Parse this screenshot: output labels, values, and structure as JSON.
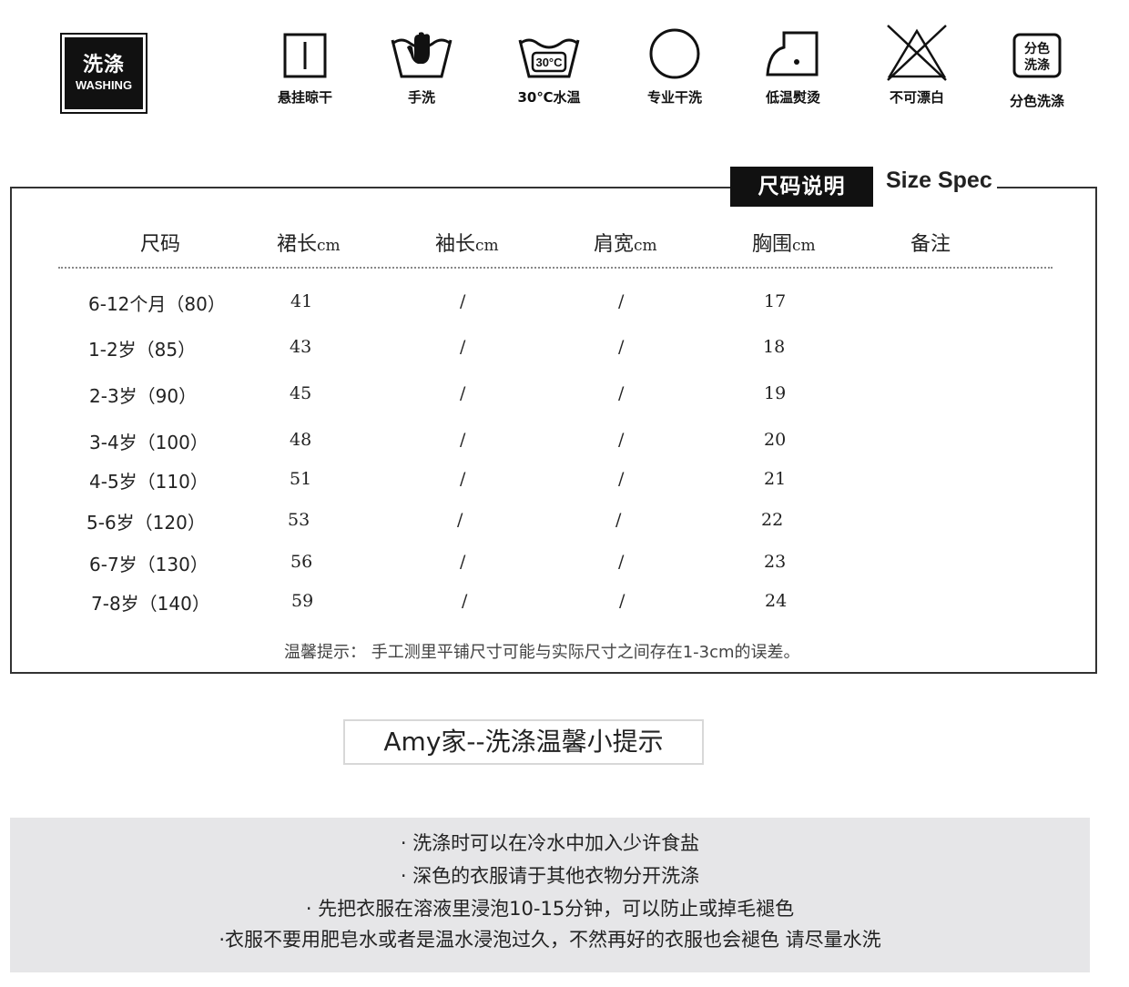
{
  "washing_badge": {
    "cn": "洗涤",
    "en": "WASHING"
  },
  "care_icons": [
    {
      "icon": "hang-dry-icon",
      "label": "悬挂晾干"
    },
    {
      "icon": "hand-wash-icon",
      "label": "手洗"
    },
    {
      "icon": "wash-30c-icon",
      "label": "30℃水温",
      "badge_text": "30°C"
    },
    {
      "icon": "dry-clean-icon",
      "label": "专业干洗"
    },
    {
      "icon": "iron-low-icon",
      "label": "低温熨烫"
    },
    {
      "icon": "no-bleach-icon",
      "label": "不可漂白"
    },
    {
      "icon": "separate-color-wash-icon",
      "label": "分色洗涤",
      "badge_line1": "分色",
      "badge_line2": "洗涤"
    }
  ],
  "size_spec": {
    "title_cn": "尺码说明",
    "title_en": "Size Spec",
    "headers": [
      {
        "text": "尺码",
        "unit": ""
      },
      {
        "text": "裙长",
        "unit": "cm"
      },
      {
        "text": "袖长",
        "unit": "cm"
      },
      {
        "text": "肩宽",
        "unit": "cm"
      },
      {
        "text": "胸围",
        "unit": "cm"
      },
      {
        "text": "备注",
        "unit": ""
      }
    ],
    "rows": [
      {
        "size": "6-12个月（80）",
        "skirt": "41",
        "sleeve": "/",
        "shoulder": "/",
        "chest": "17",
        "note": ""
      },
      {
        "size": "1-2岁（85）",
        "skirt": "43",
        "sleeve": "/",
        "shoulder": "/",
        "chest": "18",
        "note": ""
      },
      {
        "size": "2-3岁（90）",
        "skirt": "45",
        "sleeve": "/",
        "shoulder": "/",
        "chest": "19",
        "note": ""
      },
      {
        "size": "3-4岁（100）",
        "skirt": "48",
        "sleeve": "/",
        "shoulder": "/",
        "chest": "20",
        "note": ""
      },
      {
        "size": "4-5岁（110）",
        "skirt": "51",
        "sleeve": "/",
        "shoulder": "/",
        "chest": "21",
        "note": ""
      },
      {
        "size": "5-6岁（120）",
        "skirt": "53",
        "sleeve": "/",
        "shoulder": "/",
        "chest": "22",
        "note": ""
      },
      {
        "size": "6-7岁（130）",
        "skirt": "56",
        "sleeve": "/",
        "shoulder": "/",
        "chest": "23",
        "note": ""
      },
      {
        "size": "7-8岁（140）",
        "skirt": "59",
        "sleeve": "/",
        "shoulder": "/",
        "chest": "24",
        "note": ""
      }
    ],
    "note": "温馨提示： 手工测里平铺尺寸可能与实际尺寸之间存在1-3cm的误差。"
  },
  "tips": {
    "title": "Amy家--洗涤温馨小提示",
    "lines": [
      "· 洗涤时可以在冷水中加入少许食盐",
      "· 深色的衣服请于其他衣物分开洗涤",
      "· 先把衣服在溶液里浸泡10-15分钟，可以防止或掉毛褪色",
      "·衣服不要用肥皂水或者是温水浸泡过久，不然再好的衣服也会褪色 请尽量水洗"
    ]
  }
}
